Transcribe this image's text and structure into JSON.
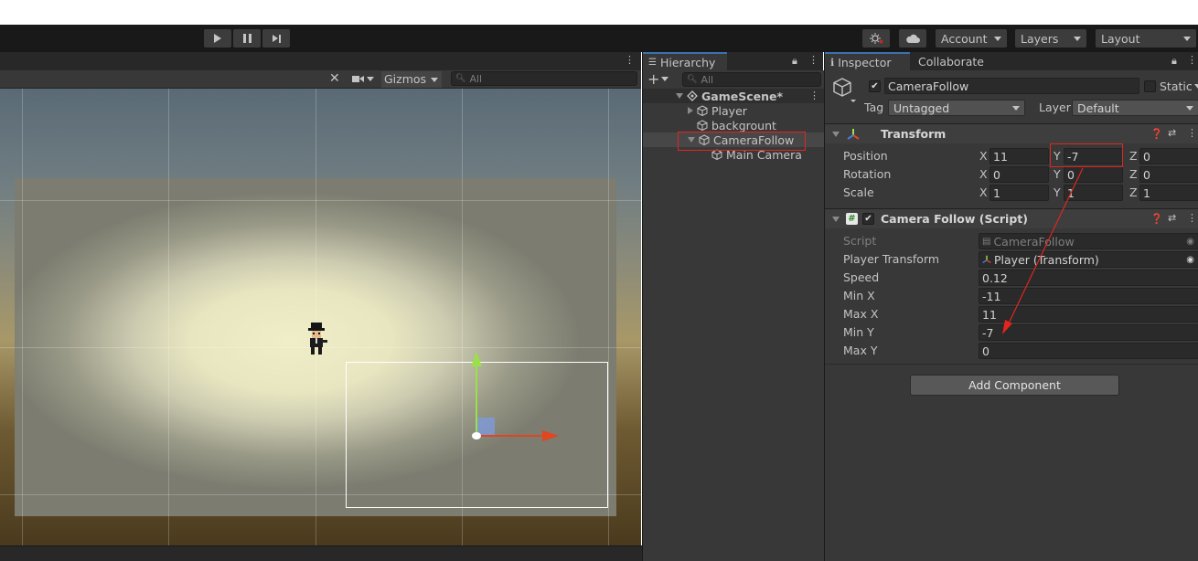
{
  "toolbar": {
    "account_label": "Account",
    "layers_label": "Layers",
    "layout_label": "Layout"
  },
  "scene": {
    "gizmos_label": "Gizmos",
    "search_placeholder": "All"
  },
  "hierarchy": {
    "tab_label": "Hierarchy",
    "search_placeholder": "All",
    "items": [
      {
        "label": "GameScene*"
      },
      {
        "label": "Player"
      },
      {
        "label": "backgrount"
      },
      {
        "label": "CameraFollow"
      },
      {
        "label": "Main Camera"
      }
    ]
  },
  "inspector": {
    "tab_label": "Inspector",
    "tab2_label": "Collaborate",
    "object_name": "CameraFollow",
    "static_label": "Static",
    "tag_label": "Tag",
    "tag_value": "Untagged",
    "layer_label": "Layer",
    "layer_value": "Default",
    "transform": {
      "title": "Transform",
      "position_label": "Position",
      "rotation_label": "Rotation",
      "scale_label": "Scale",
      "axis_x": "X",
      "axis_y": "Y",
      "axis_z": "Z",
      "position": {
        "x": "11",
        "y": "-7",
        "z": "0"
      },
      "rotation": {
        "x": "0",
        "y": "0",
        "z": "0"
      },
      "scale": {
        "x": "1",
        "y": "1",
        "z": "1"
      }
    },
    "script_component": {
      "title": "Camera Follow (Script)",
      "fields": [
        {
          "label": "Script",
          "value": "CameraFollow"
        },
        {
          "label": "Player Transform",
          "value": "Player (Transform)"
        },
        {
          "label": "Speed",
          "value": "0.12"
        },
        {
          "label": "Min X",
          "value": "-11"
        },
        {
          "label": "Max X",
          "value": "11"
        },
        {
          "label": "Min Y",
          "value": "-7"
        },
        {
          "label": "Max Y",
          "value": "0"
        }
      ]
    },
    "add_component_label": "Add Component"
  },
  "colors": {
    "accent": "#3a72b0",
    "annotation": "#e0261f",
    "panel_bg": "#383838",
    "toolbar_bg": "#191919"
  }
}
